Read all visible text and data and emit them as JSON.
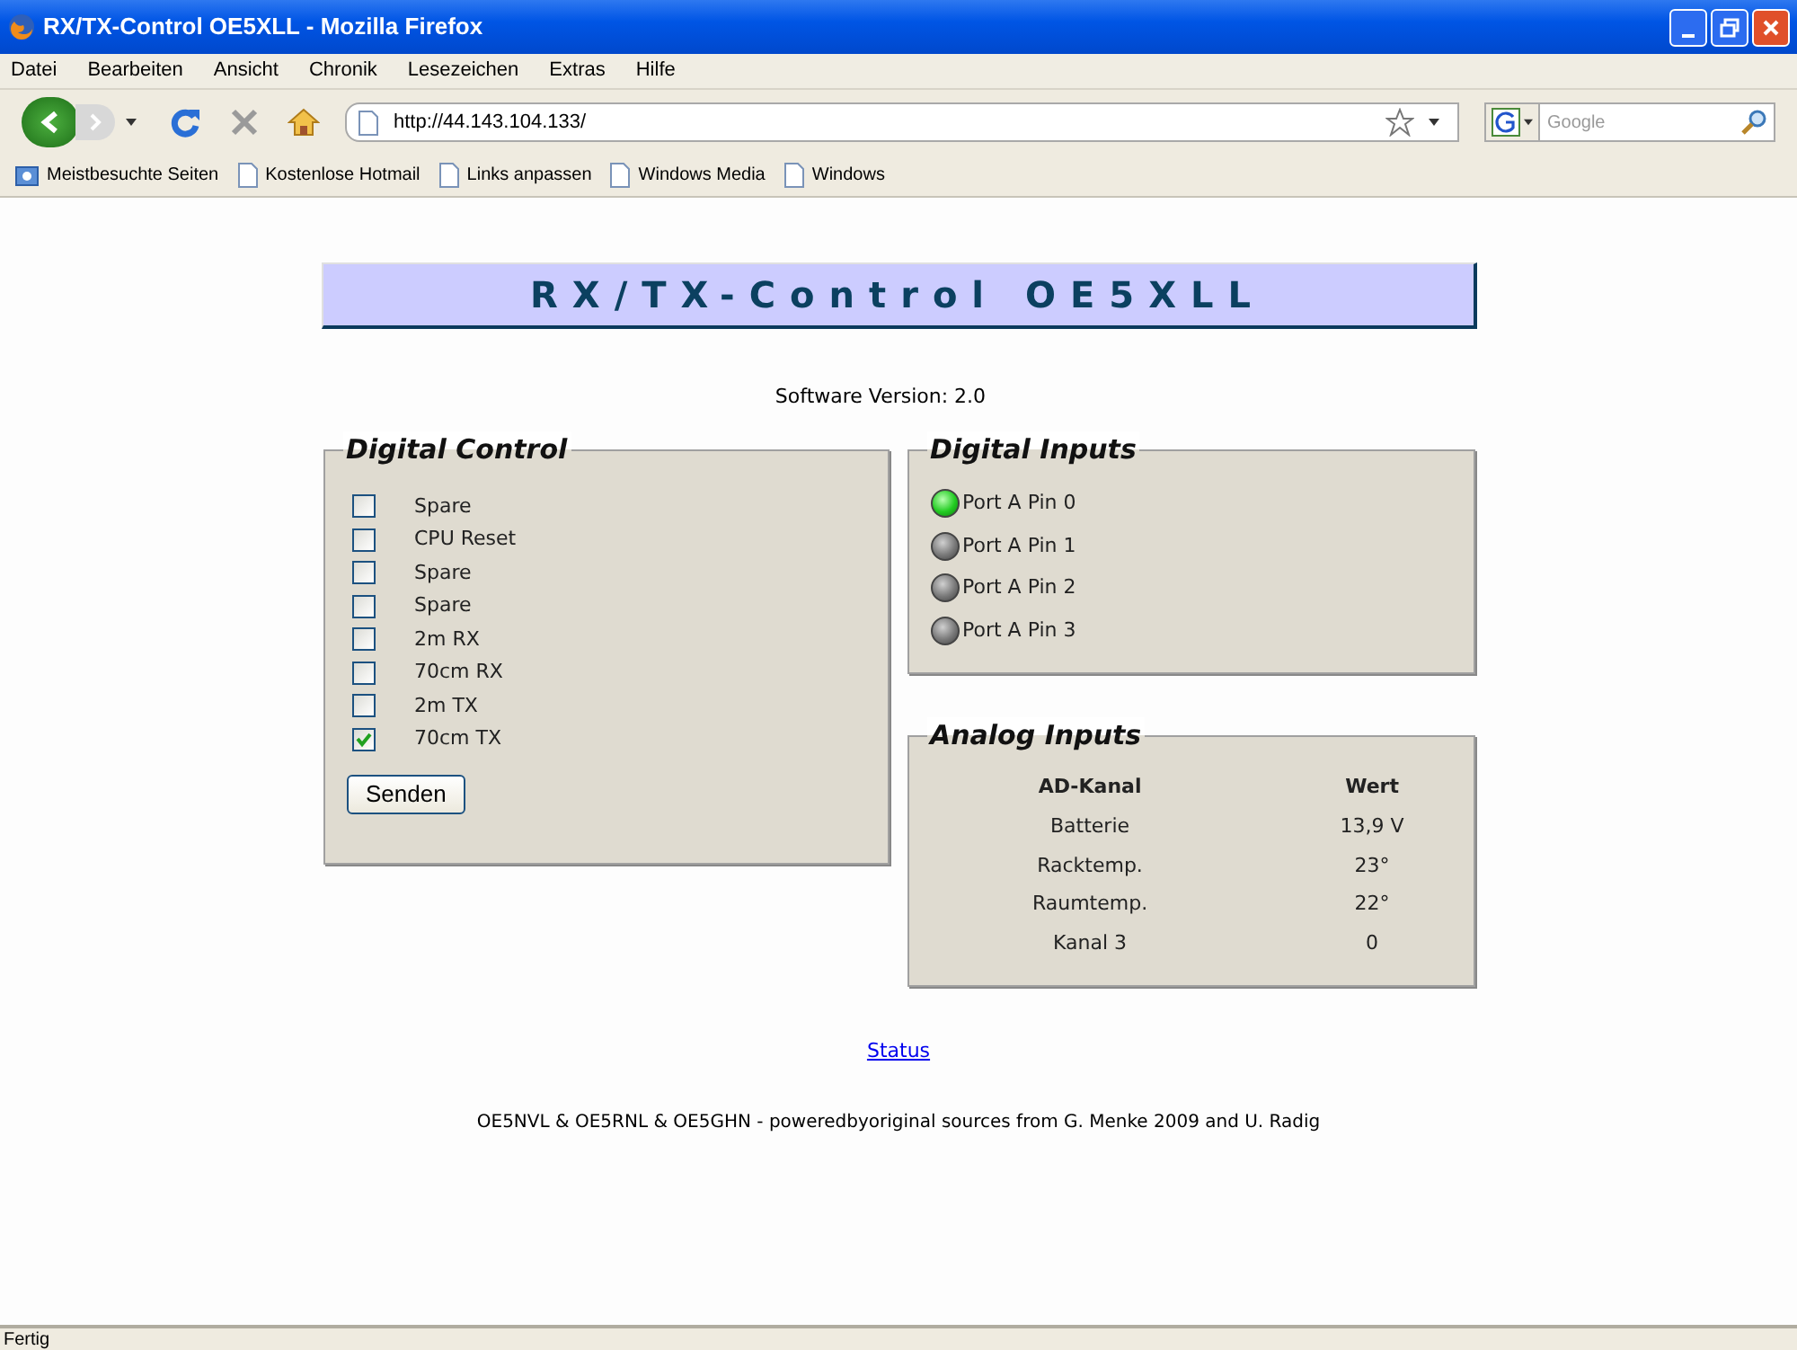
{
  "window": {
    "title": "RX/TX-Control OE5XLL - Mozilla Firefox"
  },
  "menu": [
    "Datei",
    "Bearbeiten",
    "Ansicht",
    "Chronik",
    "Lesezeichen",
    "Extras",
    "Hilfe"
  ],
  "address_bar": {
    "value": "http://44.143.104.133/"
  },
  "search": {
    "placeholder": "Google"
  },
  "bookmarks": [
    {
      "label": "Meistbesuchte Seiten",
      "kind": "folder"
    },
    {
      "label": "Kostenlose Hotmail",
      "kind": "page"
    },
    {
      "label": "Links anpassen",
      "kind": "page"
    },
    {
      "label": "Windows Media",
      "kind": "page"
    },
    {
      "label": "Windows",
      "kind": "page"
    }
  ],
  "page": {
    "banner": "RX/TX-Control OE5XLL",
    "version": "Software Version: 2.0",
    "digital_control": {
      "title": "Digital Control",
      "items": [
        {
          "label": "Spare",
          "checked": false
        },
        {
          "label": "CPU Reset",
          "checked": false
        },
        {
          "label": "Spare",
          "checked": false
        },
        {
          "label": "Spare",
          "checked": false
        },
        {
          "label": "2m RX",
          "checked": false
        },
        {
          "label": "70cm RX",
          "checked": false
        },
        {
          "label": "2m TX",
          "checked": false
        },
        {
          "label": "70cm TX",
          "checked": true
        }
      ],
      "button": "Senden"
    },
    "digital_inputs": {
      "title": "Digital Inputs",
      "items": [
        {
          "label": "Port A Pin 0",
          "on": true
        },
        {
          "label": "Port A Pin 1",
          "on": false
        },
        {
          "label": "Port A Pin 2",
          "on": false
        },
        {
          "label": "Port A Pin 3",
          "on": false
        }
      ]
    },
    "analog_inputs": {
      "title": "Analog Inputs",
      "columns": [
        "AD-Kanal",
        "Wert"
      ],
      "rows": [
        [
          "Batterie",
          "13,9 V"
        ],
        [
          "Racktemp.",
          "23°"
        ],
        [
          "Raumtemp.",
          "22°"
        ],
        [
          "Kanal 3",
          "0"
        ]
      ]
    },
    "link": "Status",
    "footer": "OE5NVL & OE5RNL & OE5GHN - poweredbyoriginal sources from G. Menke 2009 and U. Radig"
  },
  "status_bar": "Fertig"
}
